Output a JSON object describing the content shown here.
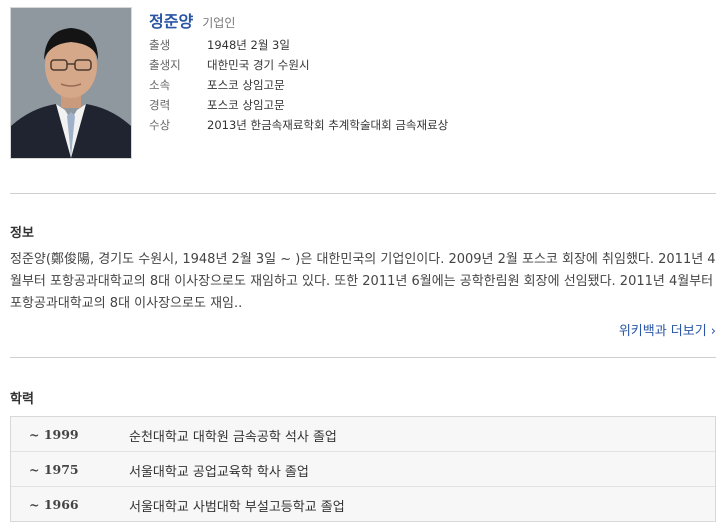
{
  "profile": {
    "name": "정준양",
    "occupation": "기업인",
    "facts": [
      {
        "label": "출생",
        "value": "1948년 2월 3일"
      },
      {
        "label": "출생지",
        "value": "대한민국 경기 수원시"
      },
      {
        "label": "소속",
        "value": "포스코 상임고문"
      },
      {
        "label": "경력",
        "value": "포스코 상임고문"
      },
      {
        "label": "수상",
        "value": "2013년 한금속재료학회 추계학술대회 금속재료상"
      }
    ]
  },
  "info": {
    "title": "정보",
    "summary": "정준양(鄭俊陽, 경기도 수원시, 1948년 2월 3일 ~ )은 대한민국의 기업인이다. 2009년 2월 포스코 회장에 취임했다. 2011년 4월부터 포항공과대학교의 8대 이사장으로도 재임하고 있다. 또한 2011년 6월에는 공학한림원 회장에 선임됐다. 2011년 4월부터 포항공과대학교의 8대 이사장으로도 재임..",
    "more_link": "위키백과 더보기 ›"
  },
  "education": {
    "title": "학력",
    "rows": [
      {
        "year": "~ 1999",
        "text": "순천대학교 대학원 금속공학 석사 졸업"
      },
      {
        "year": "~ 1975",
        "text": "서울대학교 공업교육학 학사 졸업"
      },
      {
        "year": "~ 1966",
        "text": "서울대학교 사범대학 부설고등학교 졸업"
      }
    ]
  }
}
